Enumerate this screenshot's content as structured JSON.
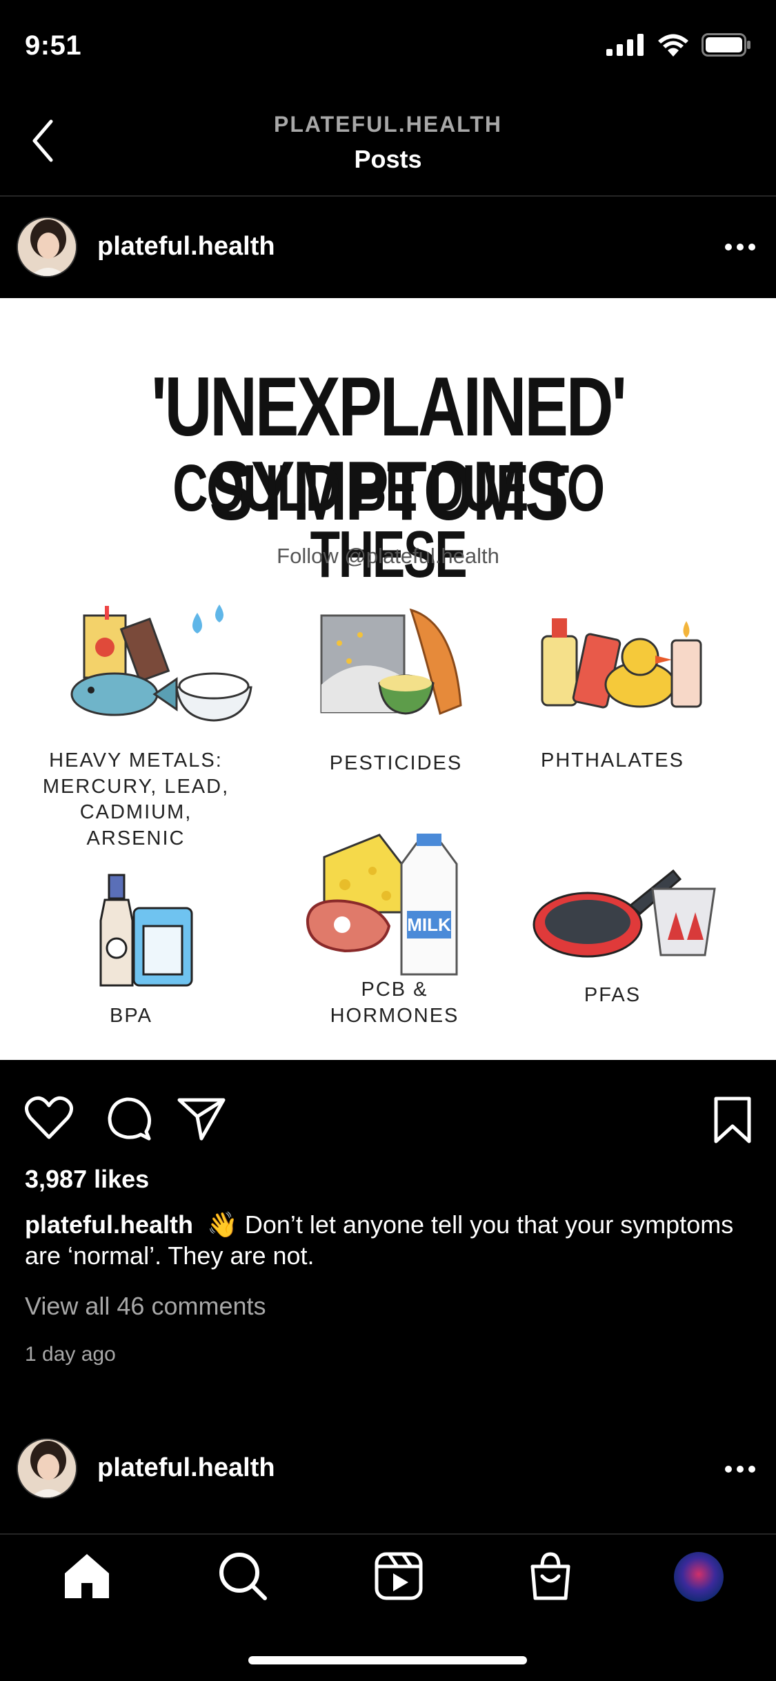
{
  "status_bar": {
    "time": "9:51"
  },
  "header": {
    "account": "PLATEFUL.HEALTH",
    "title": "Posts"
  },
  "post": {
    "username": "plateful.health",
    "image": {
      "headline1": "'UNEXPLAINED' SYMPTOMS",
      "headline2": "COULD BE DUE TO THESE",
      "follow": "Follow @plateful.health",
      "items": [
        {
          "label": "HEAVY METALS: MERCURY, LEAD, CADMIUM, ARSENIC"
        },
        {
          "label": "PESTICIDES"
        },
        {
          "label": "PHTHALATES"
        },
        {
          "label": "BPA"
        },
        {
          "label": "PCB & HORMONES"
        },
        {
          "label": "PFAS"
        }
      ],
      "milk_label": "MILK"
    },
    "likes": "3,987 likes",
    "caption_user": "plateful.health",
    "caption_text": "👋 Don’t let anyone tell you that your symptoms are ‘normal’. They are not.",
    "view_comments": "View all 46 comments",
    "time_ago": "1 day ago"
  },
  "next_post": {
    "username": "plateful.health"
  },
  "colors": {
    "background": "#000000",
    "secondary_text": "#a8a8a8",
    "divider": "#262626"
  }
}
